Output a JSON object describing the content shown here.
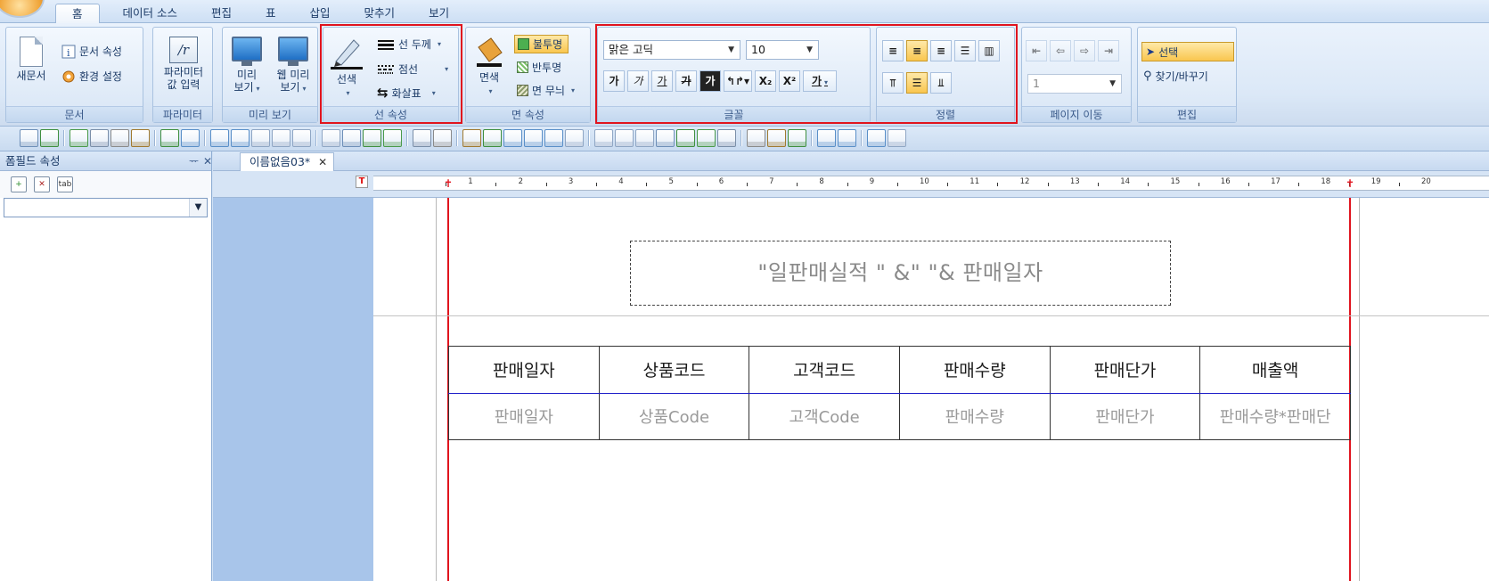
{
  "tabs": [
    {
      "label": "홈",
      "active": true
    },
    {
      "label": "데이터 소스"
    },
    {
      "label": "편집"
    },
    {
      "label": "표"
    },
    {
      "label": "삽입"
    },
    {
      "label": "맞추기"
    },
    {
      "label": "보기"
    }
  ],
  "ribbon": {
    "document": {
      "label": "문서",
      "new_doc": "새문서",
      "doc_props": "문서 속성",
      "env_settings": "환경 설정"
    },
    "parameter": {
      "label": "파라미터",
      "icon_text": "/r",
      "input_line1": "파라미터",
      "input_line2": "값 입력"
    },
    "preview": {
      "label": "미리 보기",
      "preview_line1": "미리",
      "preview_line2": "보기",
      "web_preview_line1": "웹 미리",
      "web_preview_line2": "보기"
    },
    "line_props": {
      "label": "선 속성",
      "line_color": "선색",
      "line_width": "선 두께",
      "dotted": "점선",
      "arrow": "화살표"
    },
    "face_props": {
      "label": "면 속성",
      "face_color": "면색",
      "opaque": "불투명",
      "semi_transparent": "반투명",
      "pattern": "면 무늬"
    },
    "font": {
      "label": "글꼴",
      "family": "맑은 고딕",
      "size": "10",
      "bold": "가",
      "italic": "가",
      "underline": "가",
      "strike": "가",
      "dark": "가",
      "subscript": "X₂",
      "superscript": "X²",
      "color": "가"
    },
    "align": {
      "label": "정렬"
    },
    "page_nav": {
      "label": "페이지 이동",
      "page_value": "1"
    },
    "edit": {
      "label": "편집",
      "select": "선택",
      "find_replace": "찾기/바꾸기"
    }
  },
  "left_panel": {
    "title": "폼필드 속성",
    "pin": "ᅲ",
    "close": "✕",
    "tool3": "tab"
  },
  "document_tab": {
    "name": "이름없음03*",
    "close": "✕"
  },
  "ruler": {
    "t_marker": "T",
    "numbers": [
      "1",
      "2",
      "3",
      "4",
      "5",
      "6",
      "7",
      "8",
      "9",
      "10",
      "11",
      "12",
      "13",
      "14",
      "15",
      "16",
      "17",
      "18",
      "19",
      "20"
    ]
  },
  "report": {
    "title_expr": "\"일판매실적 \" &\"   \"& 판매일자",
    "headers": [
      "판매일자",
      "상품코드",
      "고객코드",
      "판매수량",
      "판매단가",
      "매출액"
    ],
    "fields": [
      "판매일자",
      "상품Code",
      "고객Code",
      "판매수량",
      "판매단가",
      "판매수량*판매단"
    ]
  },
  "colors": {
    "highlight_frame": "#e0141e",
    "field_separator": "#1f1fc9",
    "canvas_background": "#a8c5ea"
  }
}
